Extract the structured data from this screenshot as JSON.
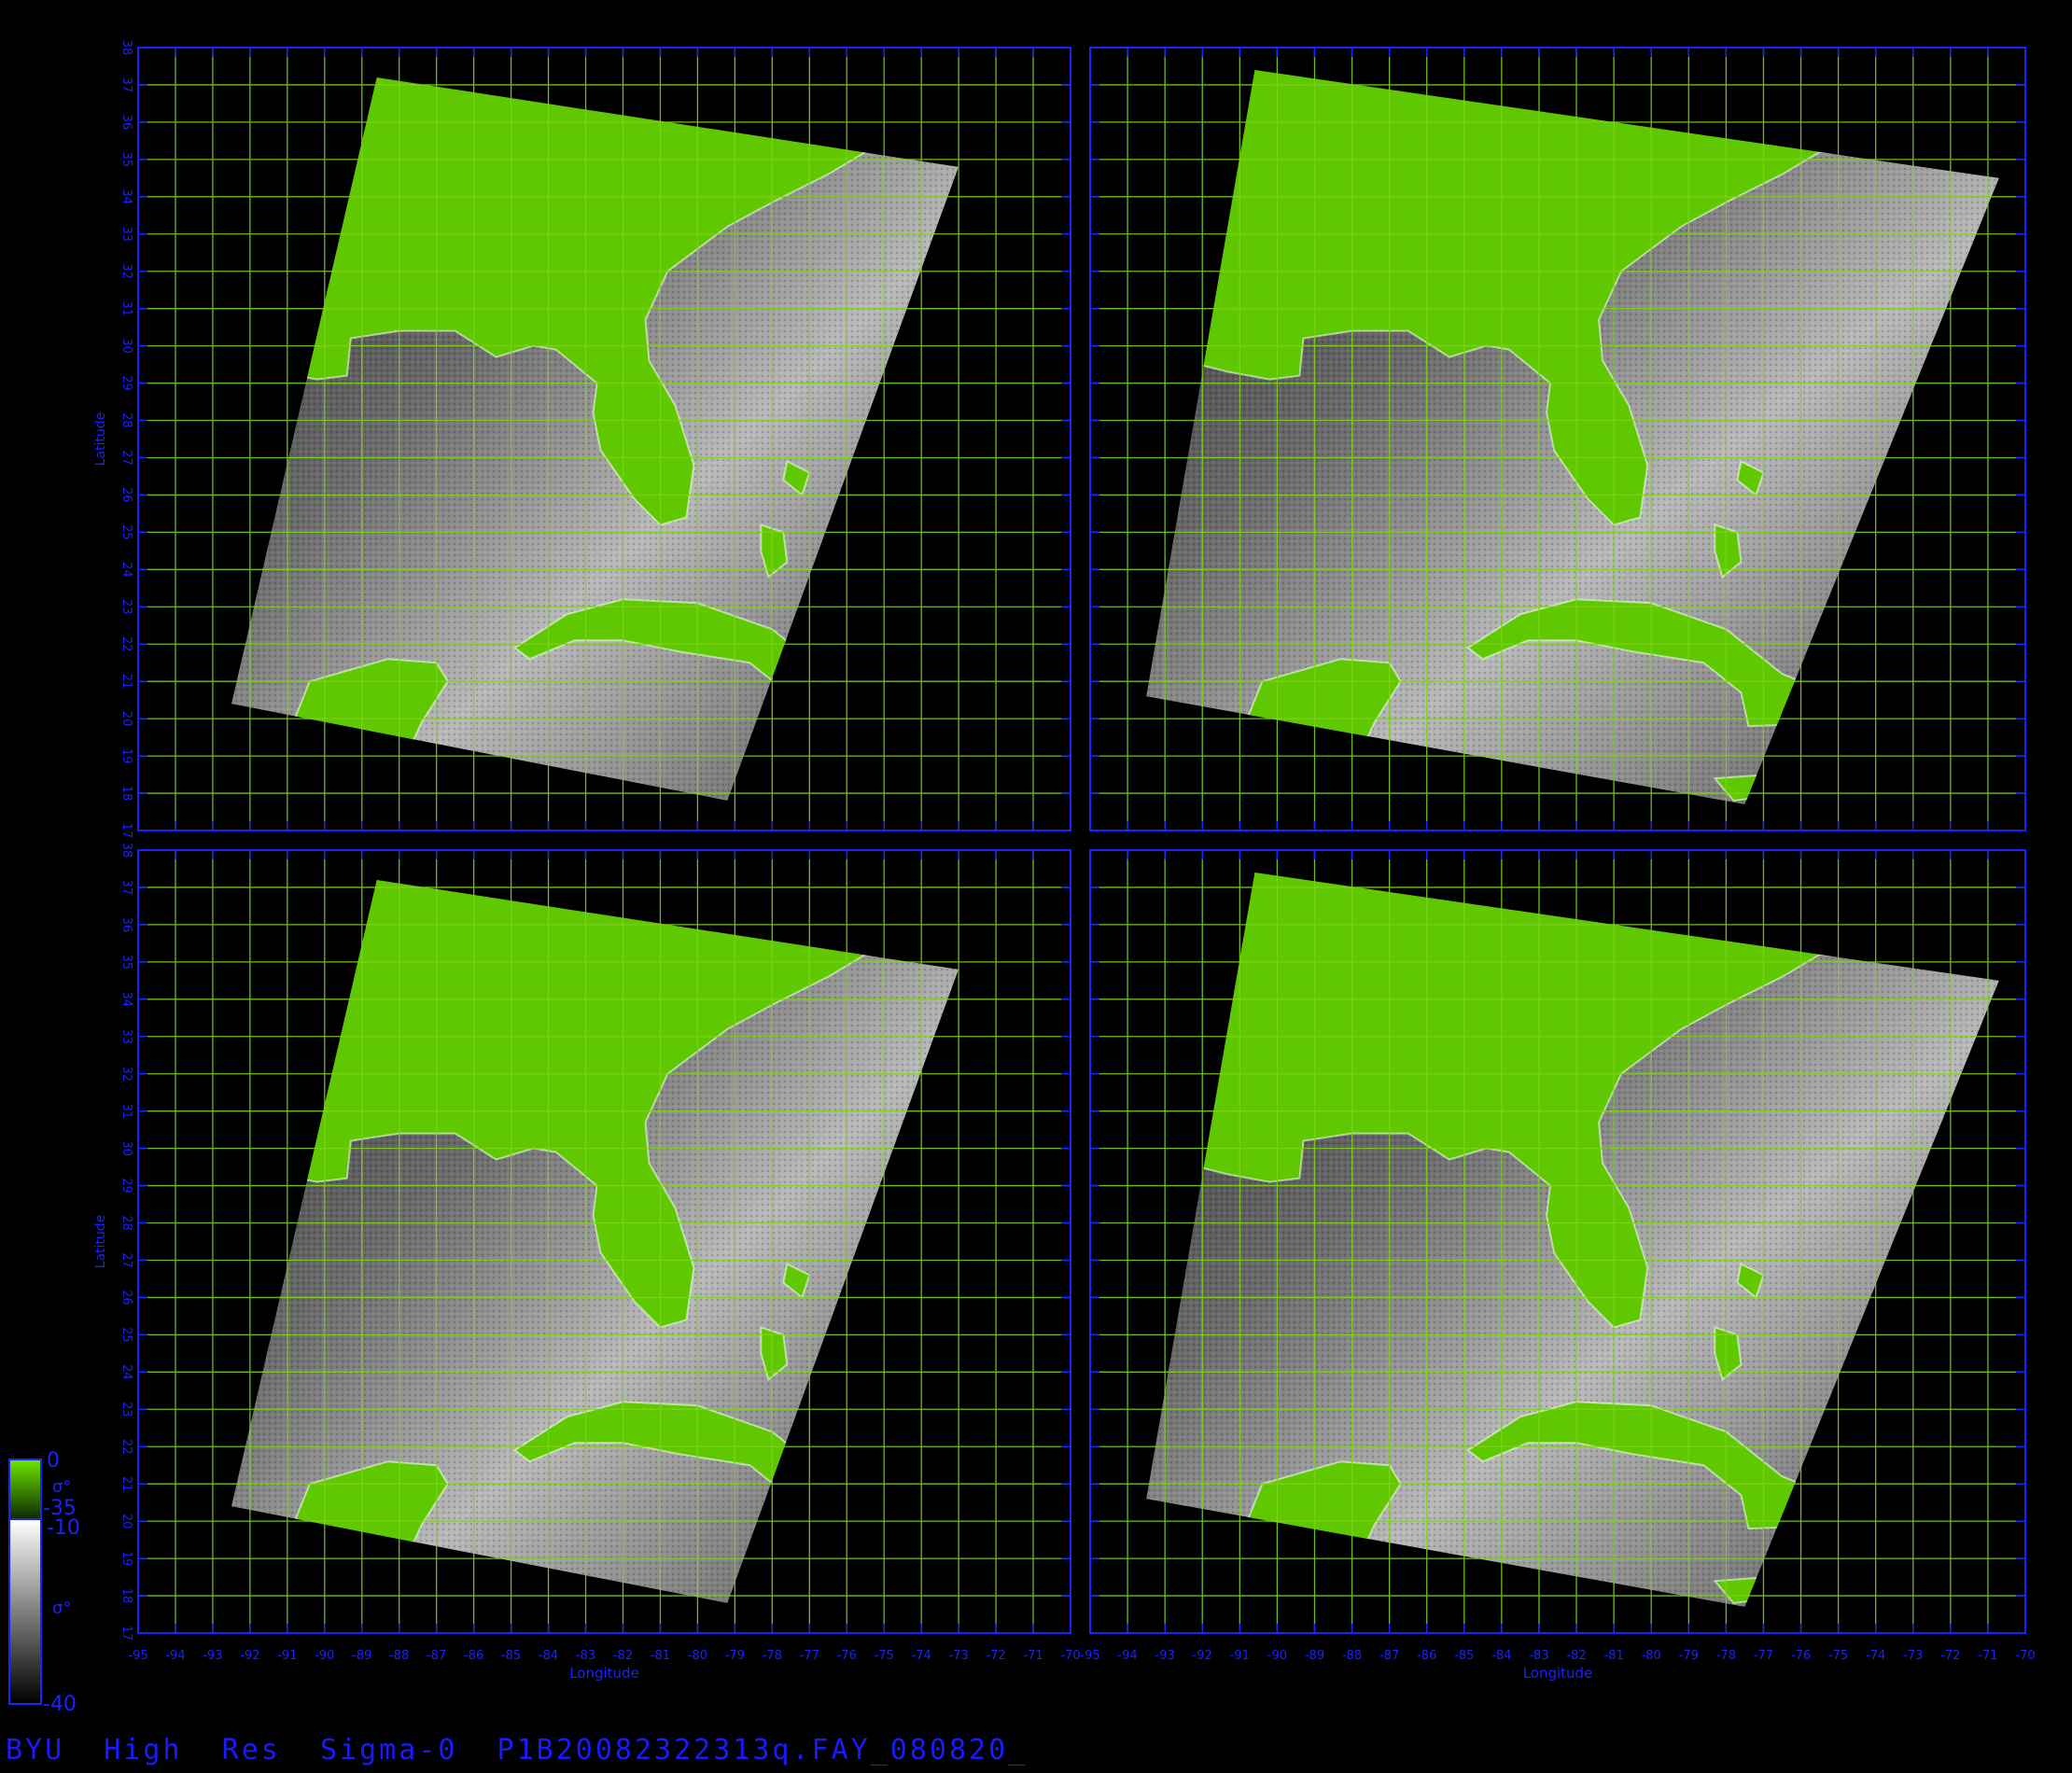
{
  "caption": "BYU  High  Res  Sigma-0  P1B20082322313q.FAY_080820_",
  "axes": {
    "x_label": "Longitude",
    "y_label": "Latitude",
    "lon_ticks": [
      -95,
      -94,
      -93,
      -92,
      -91,
      -90,
      -89,
      -88,
      -87,
      -86,
      -85,
      -84,
      -83,
      -82,
      -81,
      -80,
      -79,
      -78,
      -77,
      -76,
      -75,
      -74,
      -73,
      -72,
      -71,
      -70
    ],
    "lat_ticks": [
      17,
      18,
      19,
      20,
      21,
      22,
      23,
      24,
      25,
      26,
      27,
      28,
      29,
      30,
      31,
      32,
      33,
      34,
      35,
      36,
      37,
      38
    ],
    "lon_range": [
      -95,
      -70
    ],
    "lat_range": [
      17,
      38
    ]
  },
  "colors": {
    "frame": "#1a22ff",
    "grid": "#7fd21a",
    "land": "#5fc800",
    "background": "#000000"
  },
  "colorbar": {
    "land_top": "0",
    "land_bottom": "-35",
    "land_symbol": "σ°",
    "ocean_top": "-10",
    "ocean_bottom": "-40",
    "ocean_symbol": "σ°"
  },
  "panels": [
    {
      "id": "top-left",
      "swath_tilt": "narrow"
    },
    {
      "id": "top-right",
      "swath_tilt": "wide"
    },
    {
      "id": "bottom-left",
      "swath_tilt": "narrow"
    },
    {
      "id": "bottom-right",
      "swath_tilt": "wide"
    }
  ]
}
